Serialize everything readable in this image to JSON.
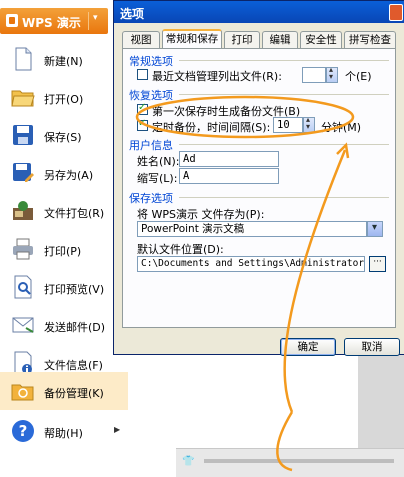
{
  "app": {
    "title": "WPS 演示"
  },
  "menu": {
    "items": [
      {
        "label": "新建(N)",
        "icon": "new-file-icon"
      },
      {
        "label": "打开(O)",
        "icon": "open-folder-icon"
      },
      {
        "label": "保存(S)",
        "icon": "save-icon"
      },
      {
        "label": "另存为(A)",
        "icon": "save-as-icon"
      },
      {
        "label": "文件打包(R)",
        "icon": "package-icon",
        "has_submenu": true
      },
      {
        "label": "打印(P)",
        "icon": "print-icon"
      },
      {
        "label": "打印预览(V)",
        "icon": "print-preview-icon"
      },
      {
        "label": "发送邮件(D)",
        "icon": "send-mail-icon"
      },
      {
        "label": "文件信息(F)",
        "icon": "file-info-icon"
      },
      {
        "label": "备份管理(K)",
        "icon": "backup-icon"
      },
      {
        "label": "帮助(H)",
        "icon": "help-icon",
        "has_submenu": true
      }
    ]
  },
  "dialog": {
    "title": "选项",
    "tabs": [
      "视图",
      "常规和保存",
      "打印",
      "编辑",
      "安全性",
      "拼写检查"
    ],
    "active_tab": "常规和保存",
    "general": {
      "section": "常规选项",
      "recent_files_label": "最近文档管理列出文件(R):",
      "recent_files_value": "",
      "recent_files_unit": "个(E)"
    },
    "recovery": {
      "section": "恢复选项",
      "backup_first_save": "第一次保存时生成备份文件(B)",
      "timed_backup_label": "定时备份，时间间隔(S):",
      "timed_backup_value": "10",
      "timed_backup_unit": "分钟(M)"
    },
    "user_info": {
      "section": "用户信息",
      "name_label": "姓名(N):",
      "name_value": "Ad",
      "initials_label": "缩写(L):",
      "initials_value": "A"
    },
    "save_options": {
      "section": "保存选项",
      "save_as_label": "将 WPS演示 文件存为(P):",
      "save_as_value": "PowerPoint 演示文稿",
      "default_location_label": "默认文件位置(D):",
      "default_location_value": "C:\\Documents and Settings\\Administrator\\My Doc",
      "browse_label": "···"
    },
    "ok_label": "确定",
    "cancel_label": "取消"
  },
  "colors": {
    "highlight": "#f39a1e",
    "title_bar": "#0a5fd8",
    "section_title": "#0046d5"
  }
}
